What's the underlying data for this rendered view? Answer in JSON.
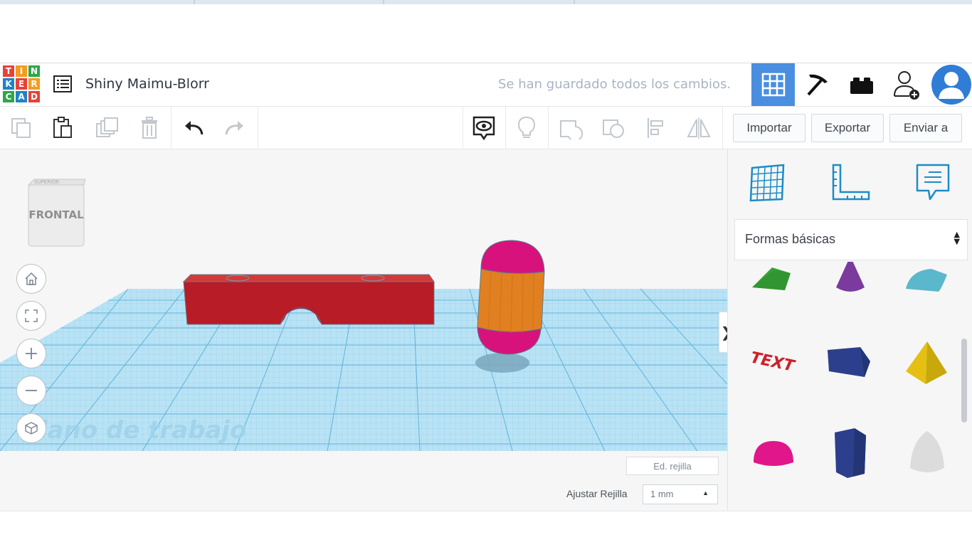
{
  "app": {
    "logo_letters": [
      "T",
      "I",
      "N",
      "K",
      "E",
      "R",
      "C",
      "A",
      "D"
    ],
    "logo_colors": [
      "#e8413a",
      "#f39c23",
      "#2da649",
      "#1f83c4",
      "#e8413a",
      "#f39c23",
      "#2da649",
      "#1f83c4",
      "#e8413a"
    ],
    "design_title": "Shiny Maimu-Blorr",
    "save_status": "Se han guardado todos los cambios.",
    "accent_color": "#4a8ee0"
  },
  "header_buttons": [
    {
      "name": "3d-design-view",
      "icon": "grid-icon",
      "active": true
    },
    {
      "name": "circuits-view",
      "icon": "pickaxe-icon",
      "active": false
    },
    {
      "name": "blocks-view",
      "icon": "bricks-icon",
      "active": false
    },
    {
      "name": "add-user",
      "icon": "add-user-icon",
      "active": false
    },
    {
      "name": "user-avatar",
      "icon": "avatar-icon",
      "active": false
    }
  ],
  "toolbar": {
    "tools": [
      "copy-icon",
      "paste-icon",
      "duplicate-icon",
      "delete-icon",
      "undo-icon",
      "redo-icon"
    ],
    "view_tools": [
      "show-all-icon",
      "light-icon",
      "group-icon",
      "ungroup-icon",
      "align-icon",
      "mirror-icon"
    ],
    "import_label": "Importar",
    "export_label": "Exportar",
    "send_label": "Enviar a"
  },
  "viewport": {
    "view_cube_label": "FRONTAL",
    "view_cube_top_label": "SUPERIOR",
    "workplane_label": "Plano de trabajo",
    "edit_grid_label": "Ed. rejilla",
    "snap_grid_label": "Ajustar Rejilla",
    "snap_grid_value": "1 mm",
    "nav_controls": [
      "home-icon",
      "fit-view-icon",
      "zoom-in-icon",
      "zoom-out-icon",
      "perspective-icon"
    ]
  },
  "panel": {
    "top_icons": [
      "workplane-icon",
      "ruler-icon",
      "notes-icon"
    ],
    "shape_library": "Formas básicas",
    "shapes": [
      {
        "name": "roof-shape",
        "color": "#3aa83a"
      },
      {
        "name": "cone-shape",
        "color": "#7b3a9e"
      },
      {
        "name": "half-cylinder-shape",
        "color": "#5bb7cc"
      },
      {
        "name": "text-shape",
        "color": "#cc2229",
        "label": "TEXT"
      },
      {
        "name": "polygon-shape",
        "color": "#2c3f8c"
      },
      {
        "name": "pyramid-shape",
        "color": "#e5c012"
      },
      {
        "name": "hemisphere-shape",
        "color": "#e0168a"
      },
      {
        "name": "hexagonal-prism-shape",
        "color": "#2c3f8c"
      },
      {
        "name": "paraboloid-shape",
        "color": "#dcdcdc"
      }
    ]
  }
}
